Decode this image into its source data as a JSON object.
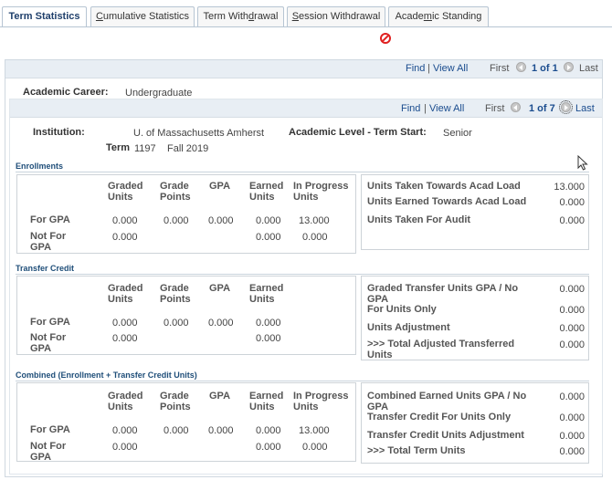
{
  "tabs": [
    {
      "label_pre": "Term Statistics",
      "u": "",
      "label_post": ""
    },
    {
      "label_pre": "",
      "u": "C",
      "label_post": "umulative Statistics"
    },
    {
      "label_pre": "Term With",
      "u": "d",
      "label_post": "rawal"
    },
    {
      "label_pre": "",
      "u": "S",
      "label_post": "ession Withdrawal"
    },
    {
      "label_pre": "Acade",
      "u": "m",
      "label_post": "ic Standing"
    }
  ],
  "outer_nav": {
    "find": "Find",
    "sep": "|",
    "view_all": "View All",
    "first": "First",
    "count": "1 of 1",
    "last": "Last"
  },
  "career": {
    "label": "Academic Career:",
    "value": "Undergraduate"
  },
  "inner_nav": {
    "find": "Find",
    "sep": "|",
    "view_all": "View All",
    "first": "First",
    "count": "1 of 7",
    "last": "Last"
  },
  "institution": {
    "label": "Institution:",
    "value": "U. of Massachusetts Amherst"
  },
  "academic_level": {
    "label": "Academic Level - Term Start:",
    "value": "Senior"
  },
  "term": {
    "label": "Term",
    "code": "1197",
    "name": "Fall 2019"
  },
  "enrollments": {
    "title": "Enrollments",
    "headers": [
      "Graded Units",
      "Grade Points",
      "GPA",
      "Earned Units",
      "In Progress Units"
    ],
    "rows": [
      {
        "label": "For GPA",
        "values": [
          "0.000",
          "0.000",
          "0.000",
          "0.000",
          "13.000"
        ]
      },
      {
        "label": "Not For GPA",
        "values": [
          "0.000",
          "",
          "",
          "0.000",
          "0.000"
        ]
      }
    ],
    "right": [
      {
        "label": "Units Taken Towards Acad Load",
        "value": "13.000"
      },
      {
        "label": "Units Earned Towards Acad Load",
        "value": "0.000"
      },
      {
        "label": "Units Taken For Audit",
        "value": "0.000"
      }
    ]
  },
  "transfer": {
    "title": "Transfer Credit",
    "headers": [
      "Graded Units",
      "Grade Points",
      "GPA",
      "Earned Units"
    ],
    "rows": [
      {
        "label": "For GPA",
        "values": [
          "0.000",
          "0.000",
          "0.000",
          "0.000"
        ]
      },
      {
        "label": "Not For GPA",
        "values": [
          "0.000",
          "",
          "",
          "0.000"
        ]
      }
    ],
    "right": [
      {
        "label": "Graded Transfer Units GPA / No GPA",
        "value": "0.000"
      },
      {
        "label": "For Units Only",
        "value": "0.000"
      },
      {
        "label": "Units Adjustment",
        "value": "0.000"
      },
      {
        "label": ">>> Total Adjusted Transferred Units",
        "value": "0.000"
      }
    ]
  },
  "combined": {
    "title": "Combined (Enrollment + Transfer Credit Units)",
    "headers": [
      "Graded Units",
      "Grade Points",
      "GPA",
      "Earned Units",
      "In Progress Units"
    ],
    "rows": [
      {
        "label": "For GPA",
        "values": [
          "0.000",
          "0.000",
          "0.000",
          "0.000",
          "13.000"
        ]
      },
      {
        "label": "Not For GPA",
        "values": [
          "0.000",
          "",
          "",
          "0.000",
          "0.000"
        ]
      }
    ],
    "right": [
      {
        "label": "Combined Earned Units GPA / No GPA",
        "value": "0.000"
      },
      {
        "label": "Transfer Credit For Units Only",
        "value": "0.000"
      },
      {
        "label": "Transfer Credit Units Adjustment",
        "value": "0.000"
      },
      {
        "label": ">>> Total Term Units",
        "value": "0.000"
      }
    ]
  }
}
